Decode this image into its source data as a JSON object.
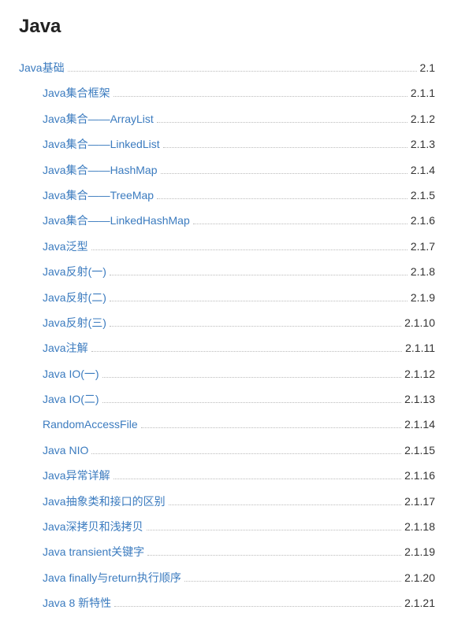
{
  "title": "Java",
  "toc": [
    {
      "label": "Java基础",
      "num": "2.1",
      "indent": 0
    },
    {
      "label": "Java集合框架",
      "num": "2.1.1",
      "indent": 1
    },
    {
      "label": "Java集合——ArrayList",
      "num": "2.1.2",
      "indent": 1
    },
    {
      "label": "Java集合——LinkedList",
      "num": "2.1.3",
      "indent": 1
    },
    {
      "label": "Java集合——HashMap",
      "num": "2.1.4",
      "indent": 1
    },
    {
      "label": "Java集合——TreeMap",
      "num": "2.1.5",
      "indent": 1
    },
    {
      "label": "Java集合——LinkedHashMap",
      "num": "2.1.6",
      "indent": 1
    },
    {
      "label": "Java泛型",
      "num": "2.1.7",
      "indent": 1
    },
    {
      "label": "Java反射(一)",
      "num": "2.1.8",
      "indent": 1
    },
    {
      "label": "Java反射(二)",
      "num": "2.1.9",
      "indent": 1
    },
    {
      "label": "Java反射(三)",
      "num": "2.1.10",
      "indent": 1
    },
    {
      "label": "Java注解",
      "num": "2.1.11",
      "indent": 1
    },
    {
      "label": "Java IO(一)",
      "num": "2.1.12",
      "indent": 1
    },
    {
      "label": "Java IO(二)",
      "num": "2.1.13",
      "indent": 1
    },
    {
      "label": "RandomAccessFile",
      "num": "2.1.14",
      "indent": 1
    },
    {
      "label": "Java NIO",
      "num": "2.1.15",
      "indent": 1
    },
    {
      "label": "Java异常详解",
      "num": "2.1.16",
      "indent": 1
    },
    {
      "label": "Java抽象类和接口的区别",
      "num": "2.1.17",
      "indent": 1
    },
    {
      "label": "Java深拷贝和浅拷贝",
      "num": "2.1.18",
      "indent": 1
    },
    {
      "label": "Java transient关键字",
      "num": "2.1.19",
      "indent": 1
    },
    {
      "label": "Java finally与return执行顺序",
      "num": "2.1.20",
      "indent": 1
    },
    {
      "label": "Java 8 新特性",
      "num": "2.1.21",
      "indent": 1
    }
  ]
}
